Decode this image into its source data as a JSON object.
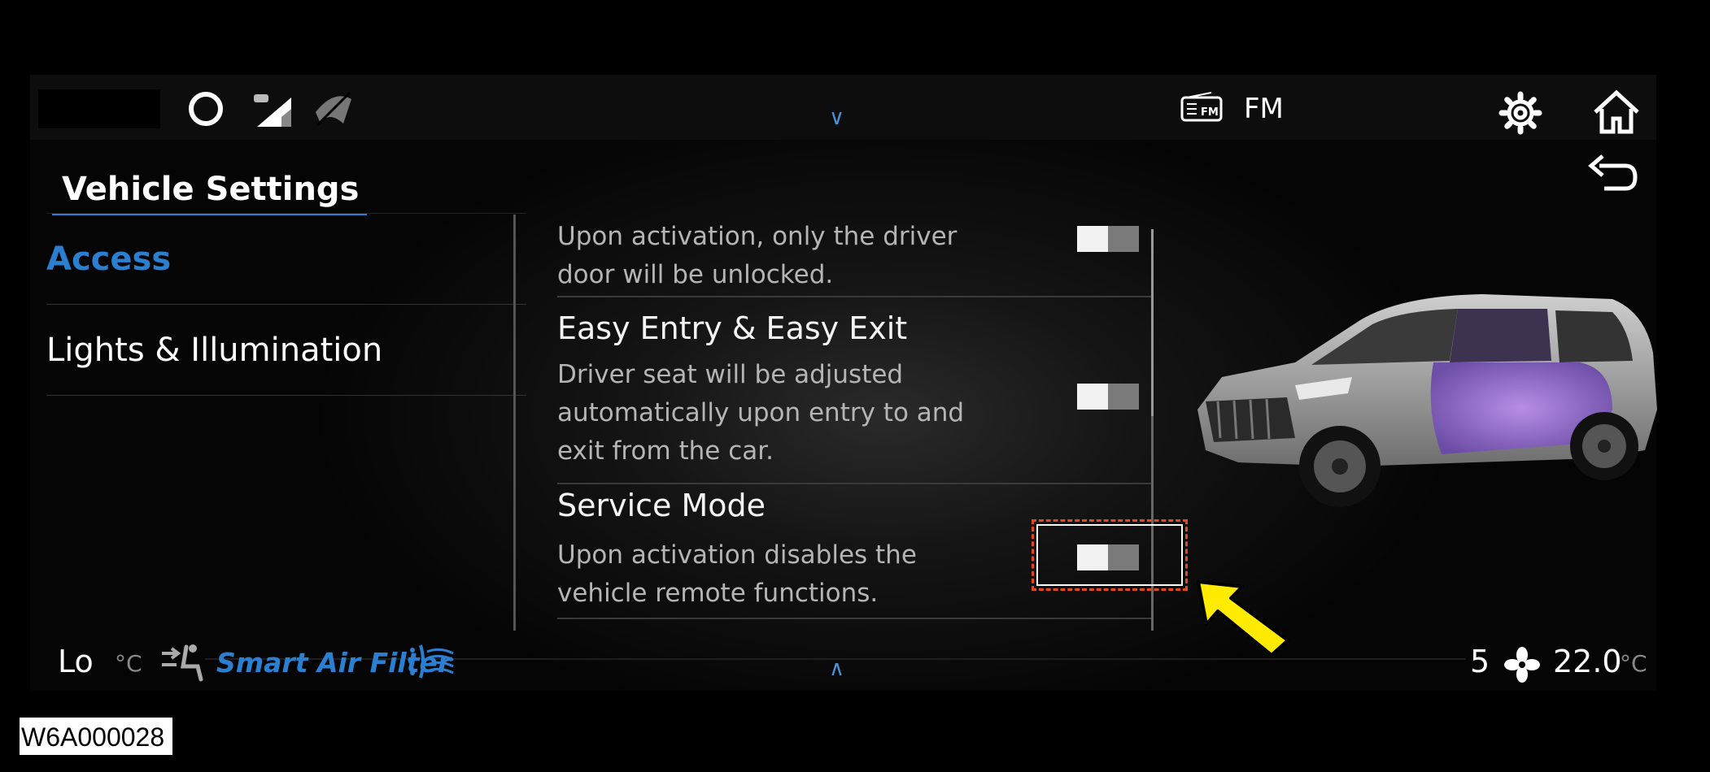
{
  "status_bar": {
    "icons": [
      "voice-assistant-icon",
      "car-signal-icon",
      "wiper-off-icon"
    ],
    "source_icon": "fm-radio-icon",
    "source_label": "FM",
    "settings_icon": "gear-icon",
    "home_icon": "home-icon",
    "back_icon": "back-arrow-icon"
  },
  "page_title": "Vehicle Settings",
  "nav": {
    "items": [
      {
        "label": "Access",
        "active": true
      },
      {
        "label": "Lights & Illumination",
        "active": false
      }
    ]
  },
  "settings": [
    {
      "title": "",
      "desc": "Upon activation, only the driver door will be unlocked.",
      "enabled": false
    },
    {
      "title": "Easy Entry & Easy Exit",
      "desc": "Driver seat will be adjusted automatically upon entry to and exit from the car.",
      "enabled": false
    },
    {
      "title": "Service Mode",
      "desc": "Upon activation disables the vehicle remote functions.",
      "enabled": false
    }
  ],
  "climate": {
    "left_temp": "Lo",
    "left_unit": "°C",
    "air_filter_label": "Smart Air Filter",
    "fan_speed": "5",
    "right_temp": "22.0",
    "right_unit": "°C"
  },
  "figure_code": "W6A000028",
  "colors": {
    "accent": "#2a7fd1",
    "highlight_border": "#e04a20",
    "arrow": "#ffeb00"
  }
}
